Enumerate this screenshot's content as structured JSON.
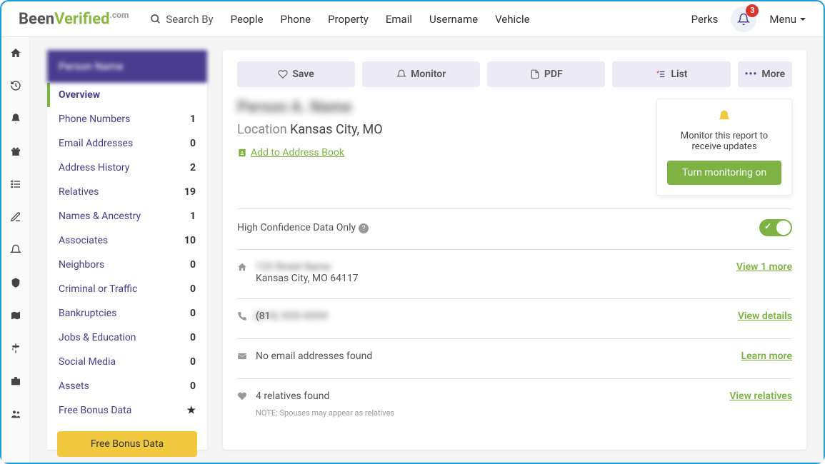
{
  "topbar": {
    "logo_a": "Been",
    "logo_b": "Verified",
    "logo_c": ".com",
    "search_by": "Search By",
    "tabs": [
      "People",
      "Phone",
      "Property",
      "Email",
      "Username",
      "Vehicle"
    ],
    "perks": "Perks",
    "notif_count": "3",
    "menu": "Menu"
  },
  "sidebar": {
    "header": "Person Name",
    "items": [
      {
        "label": "Overview",
        "count": "",
        "active": true
      },
      {
        "label": "Phone Numbers",
        "count": "1"
      },
      {
        "label": "Email Addresses",
        "count": "0"
      },
      {
        "label": "Address History",
        "count": "2"
      },
      {
        "label": "Relatives",
        "count": "19"
      },
      {
        "label": "Names & Ancestry",
        "count": "1"
      },
      {
        "label": "Associates",
        "count": "10"
      },
      {
        "label": "Neighbors",
        "count": "0"
      },
      {
        "label": "Criminal or Traffic",
        "count": "0"
      },
      {
        "label": "Bankruptcies",
        "count": "0"
      },
      {
        "label": "Jobs & Education",
        "count": "0"
      },
      {
        "label": "Social Media",
        "count": "0"
      },
      {
        "label": "Assets",
        "count": "0"
      },
      {
        "label": "Free Bonus Data",
        "count": "★"
      }
    ],
    "bonus_btn": "Free Bonus Data"
  },
  "actions": {
    "save": "Save",
    "monitor": "Monitor",
    "pdf": "PDF",
    "list": "List",
    "more": "More"
  },
  "report": {
    "name": "Person A. Name",
    "loc_label": "Location",
    "loc_value": "Kansas City, MO",
    "add_book": "Add to Address Book"
  },
  "monitor_card": {
    "text": "Monitor this report to receive updates",
    "btn": "Turn monitoring on"
  },
  "hc": {
    "label": "High Confidence Data Only"
  },
  "rows": {
    "addr_line1": "123 Street Name",
    "addr_line2": "Kansas City, MO 64117",
    "addr_link": "View 1 more",
    "phone": "(81X) XXX-XXXX",
    "phone_link": "View details",
    "email": "No email addresses found",
    "email_link": "Learn more",
    "relatives": "4 relatives found",
    "relatives_link": "View relatives",
    "note": "NOTE: Spouses may appear as relatives"
  }
}
